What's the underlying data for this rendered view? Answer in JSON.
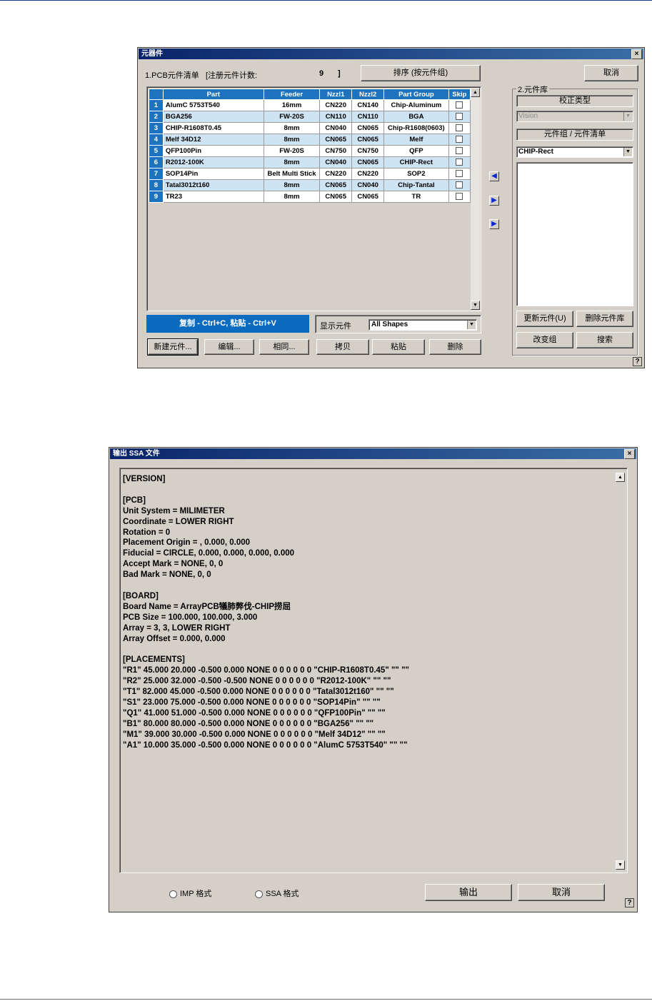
{
  "parts_dialog": {
    "title": "元器件",
    "close": "×",
    "pcb_list_label": "1.PCB元件清单",
    "register_count_label": "[注册元件计数:",
    "register_count_value": "9",
    "register_count_close": "]",
    "sort_button": "排序 (按元件组)",
    "cancel_button": "取消",
    "table": {
      "headers": [
        "",
        "Part",
        "Feeder",
        "Nzzl1",
        "Nzzl2",
        "Part Group",
        "Skip"
      ],
      "rows": [
        {
          "n": "1",
          "part": "AlumC 5753T540",
          "feeder": "16mm",
          "nzzl1": "CN220",
          "nzzl2": "CN140",
          "group": "Chip-Aluminum"
        },
        {
          "n": "2",
          "part": "BGA256",
          "feeder": "FW-20S",
          "nzzl1": "CN110",
          "nzzl2": "CN110",
          "group": "BGA"
        },
        {
          "n": "3",
          "part": "CHIP-R1608T0.45",
          "feeder": "8mm",
          "nzzl1": "CN040",
          "nzzl2": "CN065",
          "group": "Chip-R1608(0603)"
        },
        {
          "n": "4",
          "part": "Melf 34D12",
          "feeder": "8mm",
          "nzzl1": "CN065",
          "nzzl2": "CN065",
          "group": "Melf"
        },
        {
          "n": "5",
          "part": "QFP100Pin",
          "feeder": "FW-20S",
          "nzzl1": "CN750",
          "nzzl2": "CN750",
          "group": "QFP"
        },
        {
          "n": "6",
          "part": "R2012-100K",
          "feeder": "8mm",
          "nzzl1": "CN040",
          "nzzl2": "CN065",
          "group": "CHIP-Rect"
        },
        {
          "n": "7",
          "part": "SOP14Pin",
          "feeder": "Belt Multi Stick",
          "nzzl1": "CN220",
          "nzzl2": "CN220",
          "group": "SOP2"
        },
        {
          "n": "8",
          "part": "Tatal3012t160",
          "feeder": "8mm",
          "nzzl1": "CN065",
          "nzzl2": "CN040",
          "group": "Chip-Tantal"
        },
        {
          "n": "9",
          "part": "TR23",
          "feeder": "8mm",
          "nzzl1": "CN065",
          "nzzl2": "CN065",
          "group": "TR"
        }
      ]
    },
    "copy_paste_hint": "复制 - Ctrl+C, 粘贴 - Ctrl+V",
    "show_parts_label": "显示元件",
    "show_parts_value": "All Shapes",
    "bottom_buttons": [
      "新建元件...",
      "编辑...",
      "相同...",
      "拷贝",
      "粘贴",
      "删除"
    ],
    "library": {
      "group_label": "2.元件库",
      "calibration_type_label": "校正类型",
      "calibration_type_value": "Vision",
      "group_list_label": "元件组 / 元件清单",
      "group_value": "CHIP-Rect",
      "update_button": "更新元件(U)",
      "delete_library_button": "删除元件库",
      "change_group_button": "改变组",
      "search_button": "搜索"
    },
    "help": "?"
  },
  "ssa_dialog": {
    "title": "输出 SSA 文件",
    "close": "×",
    "content": "[VERSION]\n\n[PCB]\nUnit System = MILIMETER\nCoordinate = LOWER RIGHT\nRotation = 0\nPlacement Origin = , 0.000, 0.000\nFiducial = CIRCLE, 0.000, 0.000, 0.000, 0.000\nAccept Mark = NONE, 0, 0\nBad Mark = NONE, 0, 0\n\n[BOARD]\nBoard Name = ArrayPCB犠肺弊伐-CHIP捞屈\nPCB Size = 100.000, 100.000, 3.000\nArray = 3, 3, LOWER RIGHT\nArray Offset = 0.000, 0.000\n\n[PLACEMENTS]\n\"R1\" 45.000 20.000 -0.500 0.000 NONE 0 0 0 0 0 0 \"CHIP-R1608T0.45\" \"\" \"\"\n\"R2\" 25.000 32.000 -0.500 -0.500 NONE 0 0 0 0 0 0 \"R2012-100K\" \"\" \"\"\n\"T1\" 82.000 45.000 -0.500 0.000 NONE 0 0 0 0 0 0 \"Tatal3012t160\" \"\" \"\"\n\"S1\" 23.000 75.000 -0.500 0.000 NONE 0 0 0 0 0 0 \"SOP14Pin\" \"\" \"\"\n\"Q1\" 41.000 51.000 -0.500 0.000 NONE 0 0 0 0 0 0 \"QFP100Pin\" \"\" \"\"\n\"B1\" 80.000 80.000 -0.500 0.000 NONE 0 0 0 0 0 0 \"BGA256\" \"\" \"\"\n\"M1\" 39.000 30.000 -0.500 0.000 NONE 0 0 0 0 0 0 \"Melf 34D12\" \"\" \"\"\n\"A1\" 10.000 35.000 -0.500 0.000 NONE 0 0 0 0 0 0 \"AlumC 5753T540\" \"\" \"\"",
    "imp_format": "IMP 格式",
    "ssa_format": "SSA 格式",
    "output_button": "输出",
    "cancel_button": "取消",
    "help": "?"
  },
  "colors": {
    "titlebar": "#0a246a",
    "grid_header": "#1e73be",
    "grid_alt_row": "#cfe4f3",
    "dialog_face": "#d4d0c8"
  }
}
